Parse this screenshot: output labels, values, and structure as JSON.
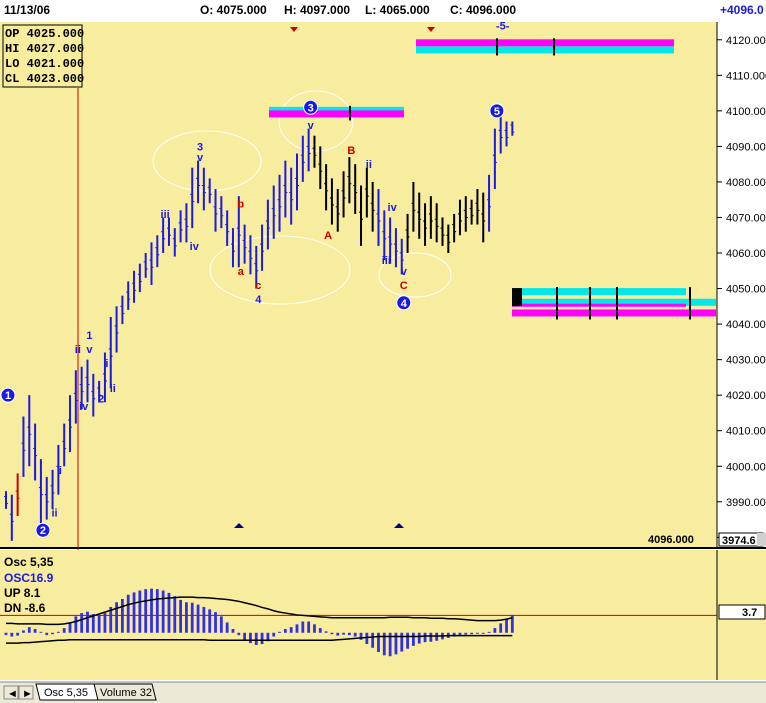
{
  "header": {
    "date": "11/13/06",
    "open": "O: 4075.000",
    "high": "H: 4097.000",
    "low": "L: 4065.000",
    "close": "C: 4096.000",
    "change": "+4096.0"
  },
  "ohlc_box": {
    "op": "OP 4025.000",
    "hi": "HI  4027.000",
    "lo": "LO  4021.000",
    "cl": "CL  4023.000"
  },
  "price_panel": {
    "last_price_label": "4096.000",
    "low_price_tag": "3974.6"
  },
  "osc_panel": {
    "title": "Osc 5,35",
    "osc_label": "OSC16.9",
    "up_label": "UP  8.1",
    "dn_label": "DN  -8.6",
    "value_tag": "3.7"
  },
  "tabs": {
    "scroll_left": "◄",
    "scroll_right": "►",
    "items": [
      "Osc 5,35",
      "Volume 32"
    ]
  },
  "colors": {
    "background": "#f8ec9e",
    "bars": "#1a1ae6",
    "black_bars": "#000000",
    "red": "#cc0000",
    "magenta": "#ff00ff",
    "cyan": "#00e8e8",
    "osc_hist": "#3030e8"
  },
  "wave_labels": [
    {
      "text": "1",
      "x": 0,
      "y": 4020,
      "color": "blue",
      "circled": true
    },
    {
      "text": "2",
      "x": 6,
      "y": 3982,
      "color": "blue",
      "circled": true
    },
    {
      "text": "i",
      "x": 9,
      "y": 3999,
      "color": "blue"
    },
    {
      "text": "ii",
      "x": 8,
      "y": 3987,
      "color": "blue"
    },
    {
      "text": "ii",
      "x": 12,
      "y": 4033,
      "color": "blue"
    },
    {
      "text": "1",
      "x": 14,
      "y": 4037,
      "color": "blue"
    },
    {
      "text": "v",
      "x": 14,
      "y": 4033,
      "color": "blue"
    },
    {
      "text": "iv",
      "x": 13,
      "y": 4017,
      "color": "blue"
    },
    {
      "text": "2",
      "x": 16,
      "y": 4019,
      "color": "blue"
    },
    {
      "text": "i",
      "x": 17,
      "y": 4029,
      "color": "blue"
    },
    {
      "text": "ii",
      "x": 18,
      "y": 4022,
      "color": "blue"
    },
    {
      "text": "iii",
      "x": 27,
      "y": 4071,
      "color": "blue"
    },
    {
      "text": "iv",
      "x": 32,
      "y": 4062,
      "color": "blue"
    },
    {
      "text": "3",
      "x": 33,
      "y": 4090,
      "color": "blue"
    },
    {
      "text": "v",
      "x": 33,
      "y": 4087,
      "color": "blue"
    },
    {
      "text": "b",
      "x": 40,
      "y": 4074,
      "color": "red"
    },
    {
      "text": "a",
      "x": 40,
      "y": 4055,
      "color": "red"
    },
    {
      "text": "c",
      "x": 43,
      "y": 4051,
      "color": "red"
    },
    {
      "text": "4",
      "x": 43,
      "y": 4047,
      "color": "blue"
    },
    {
      "text": "3",
      "x": 52,
      "y": 4101,
      "color": "blue",
      "circled": true
    },
    {
      "text": "v",
      "x": 52,
      "y": 4096,
      "color": "blue"
    },
    {
      "text": "B",
      "x": 59,
      "y": 4089,
      "color": "red"
    },
    {
      "text": "ii",
      "x": 62,
      "y": 4085,
      "color": "blue"
    },
    {
      "text": "A",
      "x": 55,
      "y": 4065,
      "color": "red"
    },
    {
      "text": "iv",
      "x": 66,
      "y": 4073,
      "color": "blue"
    },
    {
      "text": "iii",
      "x": 65,
      "y": 4058,
      "color": "blue"
    },
    {
      "text": "v",
      "x": 68,
      "y": 4055,
      "color": "blue"
    },
    {
      "text": "C",
      "x": 68,
      "y": 4051,
      "color": "red"
    },
    {
      "text": "4",
      "x": 68,
      "y": 4046,
      "color": "blue",
      "circled": true
    },
    {
      "text": "5",
      "x": 84,
      "y": 4100,
      "color": "blue",
      "circled": true
    },
    {
      "text": "-5-",
      "x": 85,
      "y": 4124,
      "color": "blue"
    }
  ],
  "chart_data": [
    {
      "type": "bar",
      "subtype": "ohlc",
      "title": "",
      "xlabel": "",
      "ylabel": "",
      "ylim": [
        3977,
        4125
      ],
      "yticks": [
        3980,
        3990,
        4000,
        4010,
        4020,
        4030,
        4040,
        4050,
        4060,
        4070,
        4080,
        4090,
        4100,
        4110,
        4120
      ],
      "yticks_labels": [
        "3980.000",
        "3990.000",
        "4000.000",
        "4010.000",
        "4020.000",
        "4030.000",
        "4040.000",
        "4050.000",
        "4060.000",
        "4070.000",
        "4080.000",
        "4090.000",
        "4100.000",
        "4110.000",
        "4120.000"
      ],
      "grid": false,
      "series": [
        {
          "values_high_low": [
            [
              3993,
              3988
            ],
            [
              3992,
              3979
            ],
            [
              3998,
              3986
            ],
            [
              4014,
              3997
            ],
            [
              4020,
              4000
            ],
            [
              4012,
              3996
            ],
            [
              4002,
              3984
            ],
            [
              3997,
              3985
            ],
            [
              3999,
              3988
            ],
            [
              4006,
              3992
            ],
            [
              4012,
              4000
            ],
            [
              4020,
              4004
            ],
            [
              4027,
              4012
            ],
            [
              4028,
              4016
            ],
            [
              4030,
              4018
            ],
            [
              4026,
              4014
            ],
            [
              4024,
              4018
            ],
            [
              4032,
              4018
            ],
            [
              4042,
              4022
            ],
            [
              4045,
              4032
            ],
            [
              4048,
              4040
            ],
            [
              4052,
              4044
            ],
            [
              4055,
              4046
            ],
            [
              4057,
              4049
            ],
            [
              4060,
              4053
            ],
            [
              4063,
              4051
            ],
            [
              4065,
              4056
            ],
            [
              4070,
              4060
            ],
            [
              4070,
              4062
            ],
            [
              4067,
              4059
            ],
            [
              4072,
              4063
            ],
            [
              4074,
              4063
            ],
            [
              4084,
              4067
            ],
            [
              4086,
              4074
            ],
            [
              4084,
              4072
            ],
            [
              4081,
              4074
            ],
            [
              4078,
              4066
            ],
            [
              4076,
              4067
            ],
            [
              4072,
              4062
            ],
            [
              4067,
              4056
            ],
            [
              4076,
              4056
            ],
            [
              4068,
              4057
            ],
            [
              4065,
              4054
            ],
            [
              4062,
              4050
            ],
            [
              4068,
              4055
            ],
            [
              4075,
              4061
            ],
            [
              4079,
              4064
            ],
            [
              4082,
              4066
            ],
            [
              4086,
              4070
            ],
            [
              4084,
              4068
            ],
            [
              4088,
              4072
            ],
            [
              4093,
              4080
            ],
            [
              4095,
              4083
            ],
            [
              4093,
              4084
            ],
            [
              4090,
              4078
            ],
            [
              4085,
              4072
            ],
            [
              4081,
              4068
            ],
            [
              4078,
              4066
            ],
            [
              4083,
              4070
            ],
            [
              4087,
              4074
            ],
            [
              4085,
              4071
            ],
            [
              4079,
              4062
            ],
            [
              4084,
              4070
            ],
            [
              4080,
              4066
            ],
            [
              4078,
              4062
            ],
            [
              4072,
              4058
            ],
            [
              4070,
              4057
            ],
            [
              4067,
              4056
            ],
            [
              4064,
              4054
            ],
            [
              4071,
              4060
            ],
            [
              4080,
              4066
            ],
            [
              4077,
              4064
            ],
            [
              4074,
              4062
            ],
            [
              4076,
              4064
            ],
            [
              4074,
              4063
            ],
            [
              4070,
              4062
            ],
            [
              4068,
              4060
            ],
            [
              4071,
              4063
            ],
            [
              4075,
              4065
            ],
            [
              4076,
              4066
            ],
            [
              4075,
              4068
            ],
            [
              4078,
              4068
            ],
            [
              4077,
              4063
            ],
            [
              4082,
              4066
            ],
            [
              4095,
              4078
            ],
            [
              4099,
              4088
            ],
            [
              4097,
              4090
            ],
            [
              4097,
              4093
            ]
          ]
        }
      ],
      "projection_bands": [
        {
          "name": "top-right",
          "levels": [
            4119,
            4117
          ]
        },
        {
          "name": "middle",
          "levels": [
            4100,
            4099
          ]
        },
        {
          "name": "lower-right",
          "levels": [
            4049,
            4046,
            4043
          ]
        }
      ]
    },
    {
      "type": "bar",
      "title": "Osc 5,35",
      "ylim": [
        -9,
        17
      ],
      "values": [
        -0.5,
        -0.8,
        -0.6,
        0.5,
        1.2,
        0.8,
        0.2,
        -0.5,
        -0.3,
        0.2,
        1.0,
        2.0,
        3.5,
        4.2,
        4.5,
        4.0,
        3.6,
        4.2,
        5.5,
        6.5,
        7.2,
        8.1,
        8.6,
        9.0,
        9.3,
        9.4,
        9.3,
        9.0,
        8.5,
        7.8,
        7.0,
        6.5,
        6.4,
        6.0,
        5.5,
        5.0,
        4.4,
        3.5,
        2.2,
        0.8,
        -0.5,
        -1.5,
        -2.2,
        -2.6,
        -2.4,
        -1.8,
        -0.8,
        0.2,
        0.8,
        1.2,
        1.8,
        2.4,
        2.4,
        1.8,
        1.0,
        0.3,
        -0.3,
        -0.6,
        -0.4,
        -0.5,
        -0.8,
        -1.5,
        -2.4,
        -3.2,
        -4.1,
        -4.8,
        -5.0,
        -4.6,
        -4.0,
        -3.4,
        -2.8,
        -2.3,
        -2.0,
        -1.9,
        -1.7,
        -1.4,
        -1.1,
        -0.8,
        -0.6,
        -0.4,
        -0.3,
        -0.2,
        -0.1,
        0.2,
        1.0,
        2.0,
        3.0,
        3.7
      ],
      "upper_band": [
        2.0,
        2.0,
        1.9,
        1.9,
        1.9,
        1.9,
        1.9,
        1.8,
        1.8,
        1.8,
        1.9,
        2.1,
        2.4,
        2.8,
        3.2,
        3.6,
        4.0,
        4.4,
        4.8,
        5.2,
        5.6,
        6.0,
        6.3,
        6.6,
        6.8,
        7.0,
        7.2,
        7.3,
        7.4,
        7.5,
        7.6,
        7.6,
        7.6,
        7.5,
        7.5,
        7.4,
        7.3,
        7.2,
        7.1,
        6.9,
        6.7,
        6.4,
        6.1,
        5.8,
        5.4,
        5.1,
        4.7,
        4.4,
        4.2,
        4.0,
        3.8,
        3.7,
        3.6,
        3.5,
        3.4,
        3.3,
        3.2,
        3.2,
        3.2,
        3.2,
        3.2,
        3.2,
        3.2,
        3.2,
        3.2,
        3.2,
        3.3,
        3.3,
        3.3,
        3.3,
        3.2,
        3.2,
        3.2,
        3.1,
        3.1,
        3.1,
        3.0,
        3.0,
        2.9,
        2.8,
        2.7,
        2.6,
        2.6,
        2.6,
        2.6,
        2.7,
        2.9,
        3.2
      ],
      "lower_band": [
        -2.2,
        -2.2,
        -2.2,
        -2.1,
        -2.1,
        -2.0,
        -1.9,
        -1.8,
        -1.7,
        -1.6,
        -1.6,
        -1.5,
        -1.5,
        -1.5,
        -1.5,
        -1.5,
        -1.5,
        -1.5,
        -1.5,
        -1.5,
        -1.5,
        -1.5,
        -1.5,
        -1.5,
        -1.5,
        -1.5,
        -1.5,
        -1.5,
        -1.5,
        -1.5,
        -1.5,
        -1.5,
        -1.5,
        -1.5,
        -1.5,
        -1.6,
        -1.6,
        -1.6,
        -1.6,
        -1.6,
        -1.6,
        -1.6,
        -1.6,
        -1.6,
        -1.6,
        -1.6,
        -1.6,
        -1.6,
        -1.6,
        -1.6,
        -1.6,
        -1.6,
        -1.6,
        -1.6,
        -1.6,
        -1.6,
        -1.6,
        -1.5,
        -1.4,
        -1.3,
        -1.2,
        -1.1,
        -1.0,
        -0.9,
        -0.8,
        -0.8,
        -0.8,
        -0.8,
        -0.8,
        -0.8,
        -0.8,
        -0.8,
        -0.7,
        -0.7,
        -0.7,
        -0.7,
        -0.6,
        -0.6,
        -0.6,
        -0.6,
        -0.6,
        -0.6,
        -0.6,
        -0.6,
        -0.6,
        -0.6,
        -0.6,
        -0.6
      ],
      "reference_line": 0
    }
  ]
}
